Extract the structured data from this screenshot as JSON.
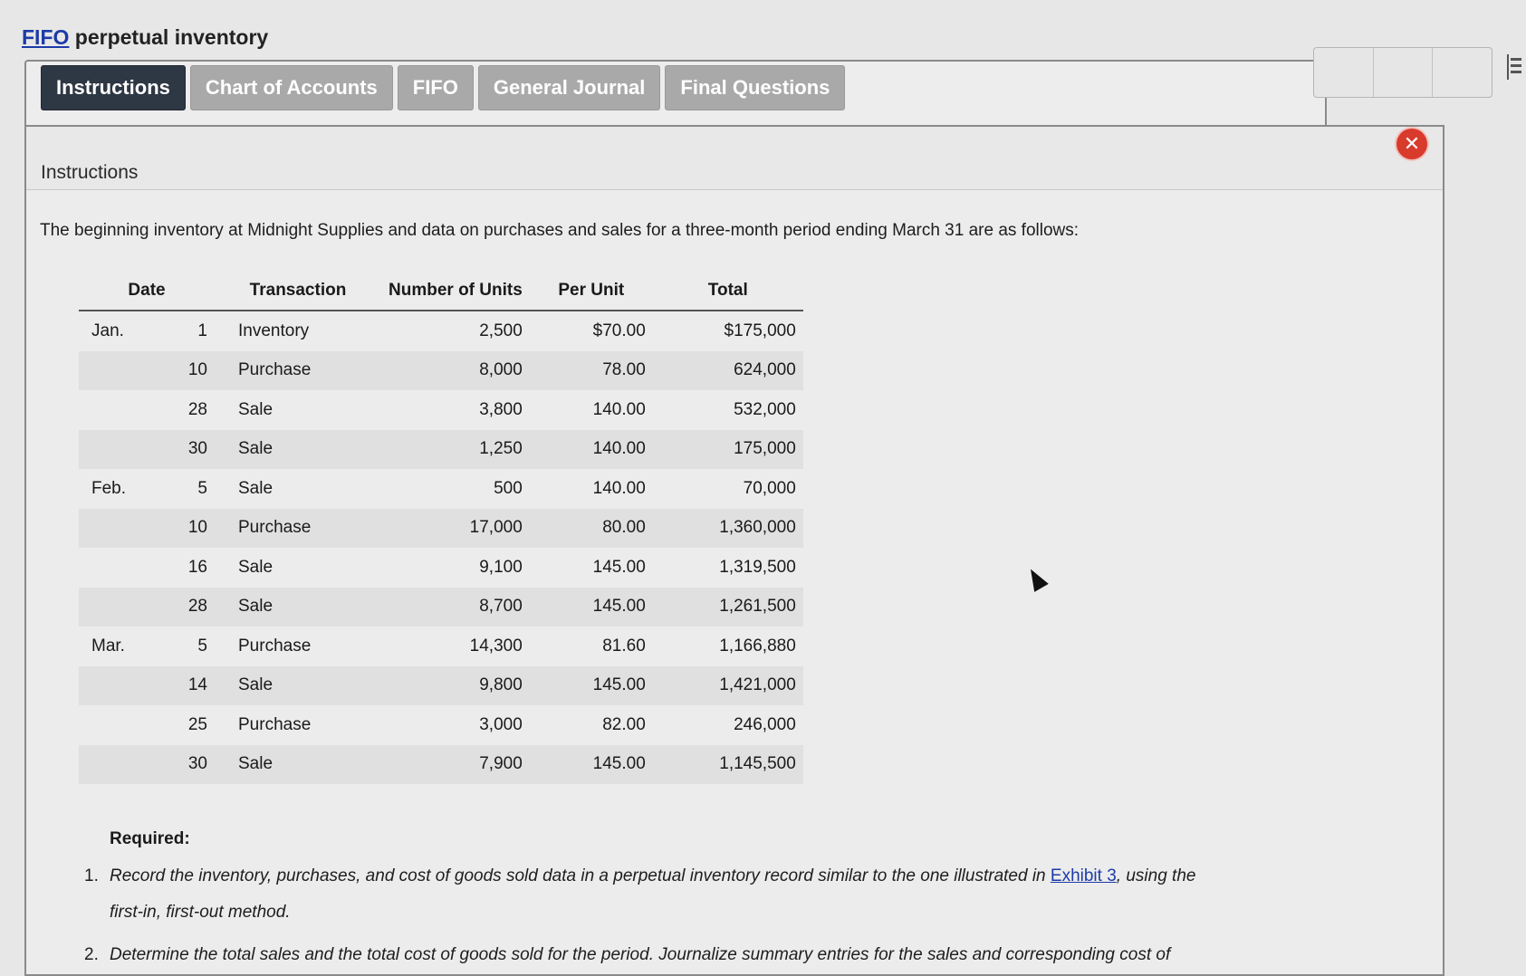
{
  "page": {
    "title_link": "FIFO",
    "title_rest": " perpetual inventory"
  },
  "tabs": [
    {
      "label": "Instructions",
      "active": true
    },
    {
      "label": "Chart of Accounts",
      "active": false
    },
    {
      "label": "FIFO",
      "active": false
    },
    {
      "label": "General Journal",
      "active": false
    },
    {
      "label": "Final Questions",
      "active": false
    }
  ],
  "panel": {
    "header": "Instructions",
    "close_glyph": "✕",
    "intro": "The beginning inventory at Midnight Supplies and data on purchases and sales for a three-month period ending March 31 are as follows:"
  },
  "table": {
    "headers": [
      "Date",
      "Transaction",
      "Number of Units",
      "Per Unit",
      "Total"
    ],
    "rows": [
      {
        "month": "Jan.",
        "day": "1",
        "transaction": "Inventory",
        "units": "2,500",
        "per_unit": "$70.00",
        "total": "$175,000"
      },
      {
        "month": "",
        "day": "10",
        "transaction": "Purchase",
        "units": "8,000",
        "per_unit": "78.00",
        "total": "624,000"
      },
      {
        "month": "",
        "day": "28",
        "transaction": "Sale",
        "units": "3,800",
        "per_unit": "140.00",
        "total": "532,000"
      },
      {
        "month": "",
        "day": "30",
        "transaction": "Sale",
        "units": "1,250",
        "per_unit": "140.00",
        "total": "175,000"
      },
      {
        "month": "Feb.",
        "day": "5",
        "transaction": "Sale",
        "units": "500",
        "per_unit": "140.00",
        "total": "70,000"
      },
      {
        "month": "",
        "day": "10",
        "transaction": "Purchase",
        "units": "17,000",
        "per_unit": "80.00",
        "total": "1,360,000"
      },
      {
        "month": "",
        "day": "16",
        "transaction": "Sale",
        "units": "9,100",
        "per_unit": "145.00",
        "total": "1,319,500"
      },
      {
        "month": "",
        "day": "28",
        "transaction": "Sale",
        "units": "8,700",
        "per_unit": "145.00",
        "total": "1,261,500"
      },
      {
        "month": "Mar.",
        "day": "5",
        "transaction": "Purchase",
        "units": "14,300",
        "per_unit": "81.60",
        "total": "1,166,880"
      },
      {
        "month": "",
        "day": "14",
        "transaction": "Sale",
        "units": "9,800",
        "per_unit": "145.00",
        "total": "1,421,000"
      },
      {
        "month": "",
        "day": "25",
        "transaction": "Purchase",
        "units": "3,000",
        "per_unit": "82.00",
        "total": "246,000"
      },
      {
        "month": "",
        "day": "30",
        "transaction": "Sale",
        "units": "7,900",
        "per_unit": "145.00",
        "total": "1,145,500"
      }
    ]
  },
  "required": {
    "label": "Required:",
    "item1": {
      "number": "1.",
      "text_before": "Record the inventory, purchases, and cost of goods sold data in a perpetual inventory record similar to the one illustrated in ",
      "link": "Exhibit 3",
      "text_after": ", using the",
      "line2": "first-in, first-out method."
    },
    "item2": {
      "number": "2.",
      "text": "Determine the total sales and the total cost of goods sold for the period. Journalize summary entries for the sales and corresponding cost of"
    }
  },
  "colors": {
    "active_tab": "#2e3744",
    "inactive_tab": "#a9a9a9",
    "link": "#1c3aa9",
    "close_button": "#d83a2c"
  }
}
